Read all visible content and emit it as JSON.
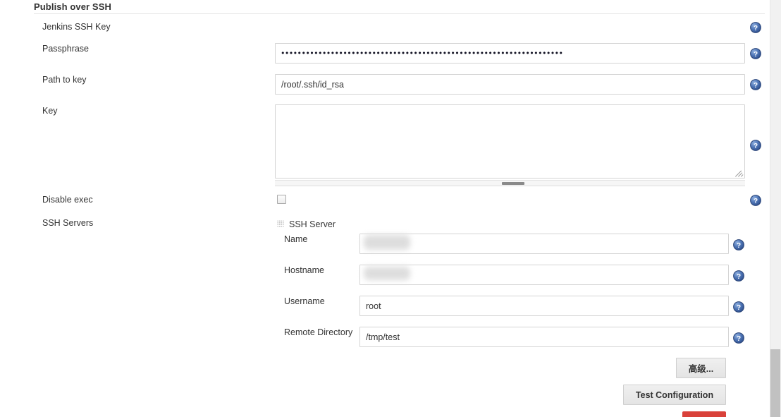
{
  "section": {
    "title": "Publish over SSH"
  },
  "rows": {
    "jenkins_ssh_key": {
      "label": "Jenkins SSH Key"
    },
    "passphrase": {
      "label": "Passphrase",
      "value": "••••••••••••••••••••••••••••••••••••••••••••••••••••••••••••••••••••"
    },
    "path_to_key": {
      "label": "Path to key",
      "value": "/root/.ssh/id_rsa"
    },
    "key": {
      "label": "Key",
      "value": ""
    },
    "disable_exec": {
      "label": "Disable exec",
      "checked": false
    },
    "ssh_servers": {
      "label": "SSH Servers"
    }
  },
  "ssh_server": {
    "title": "SSH Server",
    "grip_icon": "drag-grip-icon",
    "fields": [
      {
        "label": "Name",
        "value": "",
        "redacted": true,
        "placeholder": ""
      },
      {
        "label": "Hostname",
        "value": "",
        "redacted": true,
        "placeholder": ""
      },
      {
        "label": "Username",
        "value": "root",
        "redacted": false,
        "placeholder": ""
      },
      {
        "label": "Remote Directory",
        "value": "/tmp/test",
        "redacted": false,
        "placeholder": ""
      }
    ]
  },
  "buttons": {
    "advanced": "高级...",
    "test_configuration": "Test Configuration"
  },
  "icons": {
    "help": "help-icon",
    "checkbox": "checkbox-icon",
    "resize": "resize-handle-icon"
  },
  "colors": {
    "accent_red": "#d9413a",
    "help_blue": "#3a5d9e",
    "border": "#d4d4d4",
    "text": "#333333",
    "scrollbar_thumb": "#c1c1c1"
  }
}
